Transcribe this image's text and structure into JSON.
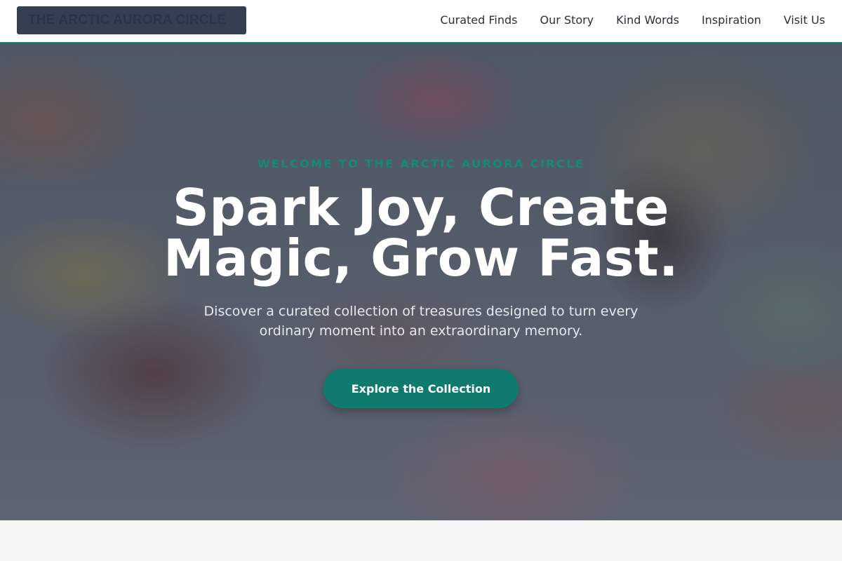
{
  "header": {
    "logo": "THE ARCTIC AURORA CIRCLE",
    "nav": [
      "Curated Finds",
      "Our Story",
      "Kind Words",
      "Inspiration",
      "Visit Us"
    ]
  },
  "hero": {
    "eyebrow": "WELCOME TO THE ARCTIC AURORA CIRCLE",
    "headline_line1": "Spark Joy, Create",
    "headline_line2": "Magic, Grow Fast.",
    "subtitle": "Discover a curated collection of treasures designed to turn every ordinary moment into an extraordinary memory.",
    "cta_label": "Explore the Collection"
  },
  "colors": {
    "accent": "#0f7a6e",
    "logo_bg": "#363f52",
    "section_bg": "#f5f5f5"
  }
}
